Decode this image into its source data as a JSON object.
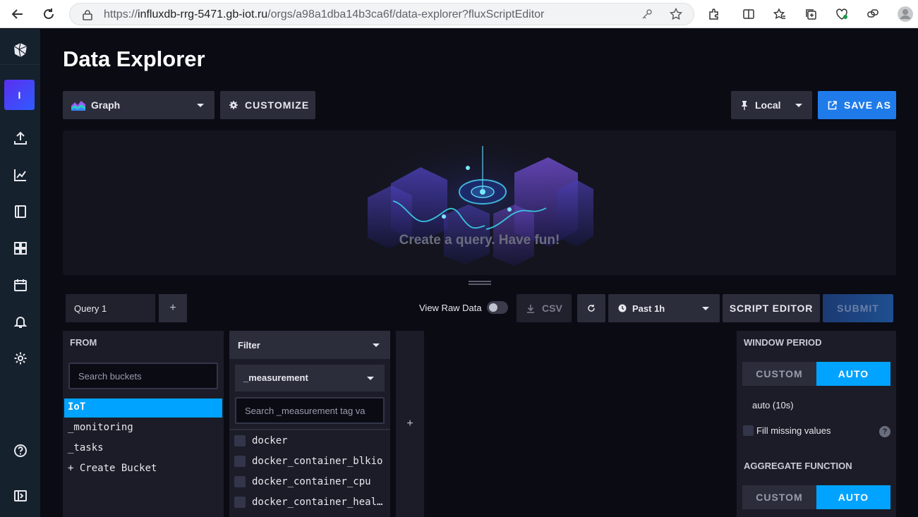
{
  "browser": {
    "url_prefix": "https://",
    "url_host": "influxdb-rrg-5471.gb-iot.ru",
    "url_path": "/orgs/a98a1dba14b3ca6f/data-explorer?fluxScriptEditor"
  },
  "nav": {
    "org_initial": "I",
    "icons": [
      "influx-logo-icon",
      "upload-icon",
      "graph-icon",
      "notebook-icon",
      "dashboards-icon",
      "calendar-icon",
      "bell-icon",
      "gear-icon",
      "help-icon",
      "expand-icon"
    ]
  },
  "page": {
    "title": "Data Explorer"
  },
  "toolbar": {
    "view_type": "Graph",
    "customize_label": "CUSTOMIZE",
    "timezone": "Local",
    "save_as_label": "SAVE AS"
  },
  "graph": {
    "empty_message": "Create a query. Have fun!"
  },
  "query_bar": {
    "query_tab": "Query 1",
    "add_label": "+",
    "view_raw_label": "View Raw Data",
    "view_raw_on": false,
    "csv_label": "CSV",
    "time_range": "Past 1h",
    "script_editor_label": "SCRIPT EDITOR",
    "submit_label": "SUBMIT"
  },
  "from": {
    "title": "FROM",
    "search_placeholder": "Search buckets",
    "buckets": [
      {
        "label": "IoT",
        "selected": true
      },
      {
        "label": "_monitoring",
        "selected": false
      },
      {
        "label": "_tasks",
        "selected": false
      },
      {
        "label": "+ Create Bucket",
        "selected": false
      }
    ]
  },
  "filter": {
    "head_label": "Filter",
    "key_selected": "_measurement",
    "search_placeholder": "Search _measurement tag va",
    "values": [
      "docker",
      "docker_container_blkio",
      "docker_container_cpu",
      "docker_container_health"
    ]
  },
  "add_filter_label": "+",
  "aggregate": {
    "window_title": "WINDOW PERIOD",
    "custom_label": "CUSTOM",
    "auto_label": "AUTO",
    "auto_value": "auto (10s)",
    "fill_label": "Fill missing values",
    "help_label": "?",
    "function_title": "AGGREGATE FUNCTION"
  },
  "colors": {
    "accent_blue": "#00a3ff",
    "save_blue": "#1f7bea",
    "nav_bg": "#15212c",
    "page_bg": "#0b0b14"
  }
}
